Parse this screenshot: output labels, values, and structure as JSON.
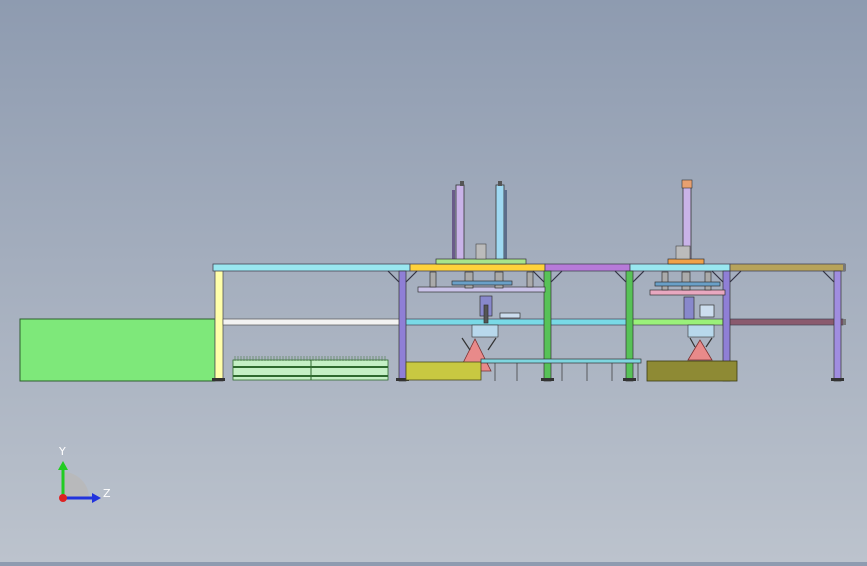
{
  "view": {
    "name": "cad-side-view",
    "background_top": "#8e9bb0",
    "background_bottom": "#bcc3cd"
  },
  "triad": {
    "y_label": "Y",
    "z_label": "Z",
    "y_color": "#22cc22",
    "z_color": "#2233dd",
    "origin_color": "#dd2222"
  },
  "parts": {
    "conveyor_block_color": "#7ee87a",
    "frame_yellow": "#ffffaa",
    "purple_post": "#8f7fd6",
    "green_post": "#57c257",
    "top_beam_cyan": "#99e7f0",
    "top_beam_yellow": "#ffd23a",
    "top_beam_purple": "#b77ad9",
    "top_beam_olive": "#b7a35a",
    "olive_box_left": "#c8c841",
    "olive_box_right": "#8e8a34",
    "pink_triangle": "#e88a8a"
  }
}
